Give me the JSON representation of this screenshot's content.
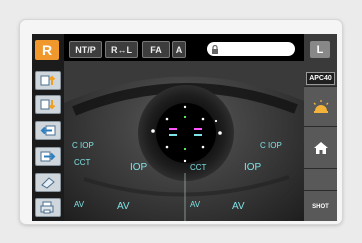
{
  "toolbar": {
    "eye_side": "R",
    "ntp": "NT/P",
    "r_l": "R↔L",
    "fa": "FA",
    "a": "A",
    "search_value": "",
    "l_side": "L"
  },
  "right": {
    "apc_label": "APC40",
    "shot": "SHOT"
  },
  "overlay": {
    "c_iop_left": "C IOP",
    "c_iop_right": "C IOP",
    "cct_left": "CCT",
    "cct_right": "CCT",
    "iop_left": "IOP",
    "iop_right": "IOP",
    "av_left_small": "AV",
    "av_left_big": "AV",
    "av_right_small": "AV",
    "av_right_big": "AV"
  },
  "colors": {
    "accent_orange": "#f0982c",
    "overlay_cyan": "#7fe3e6",
    "target_magenta": "#ff55ff"
  }
}
